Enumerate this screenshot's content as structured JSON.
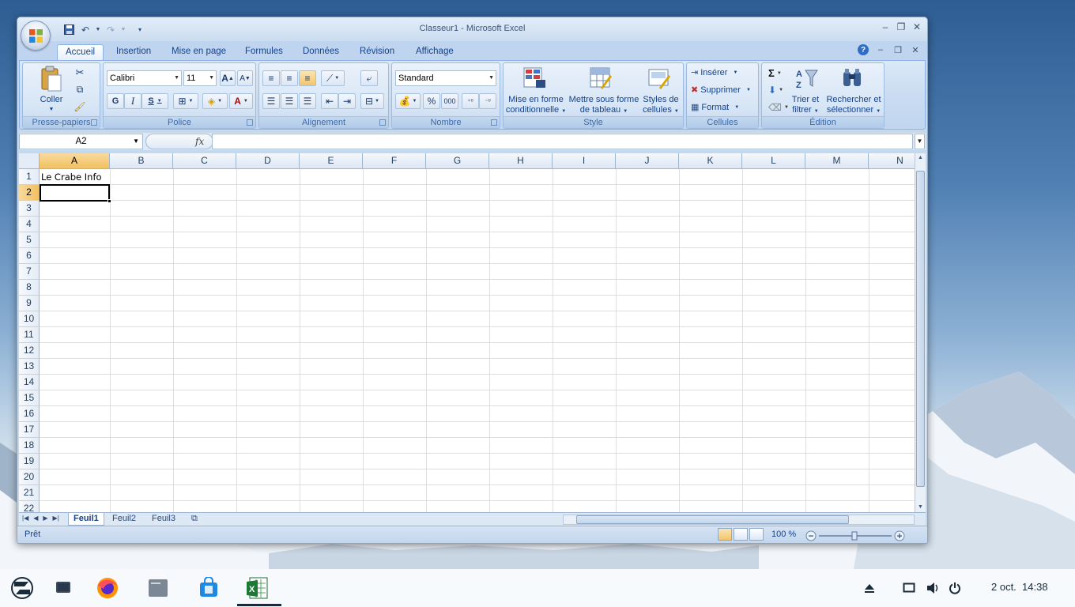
{
  "window": {
    "title": "Classeur1 - Microsoft Excel"
  },
  "ribbon_tabs": [
    "Accueil",
    "Insertion",
    "Mise en page",
    "Formules",
    "Données",
    "Révision",
    "Affichage"
  ],
  "groups": {
    "clipboard": {
      "label": "Presse-papiers",
      "paste": "Coller"
    },
    "font": {
      "label": "Police",
      "font_name": "Calibri",
      "font_size": "11",
      "bold": "G",
      "italic": "I",
      "underline": "S"
    },
    "alignment": {
      "label": "Alignement"
    },
    "number": {
      "label": "Nombre",
      "format": "Standard",
      "percent": "%",
      "thousands": "000"
    },
    "style": {
      "label": "Style",
      "cond_format_1": "Mise en forme",
      "cond_format_2": "conditionnelle",
      "table_1": "Mettre sous forme",
      "table_2": "de tableau",
      "cell_styles_1": "Styles de",
      "cell_styles_2": "cellules"
    },
    "cells": {
      "label": "Cellules",
      "insert": "Insérer",
      "delete": "Supprimer",
      "format": "Format"
    },
    "editing": {
      "label": "Édition",
      "sort_1": "Trier et",
      "sort_2": "filtrer",
      "find_1": "Rechercher et",
      "find_2": "sélectionner"
    }
  },
  "formula_bar": {
    "name_box": "A2",
    "fx": "fx",
    "formula": ""
  },
  "columns": [
    "A",
    "B",
    "C",
    "D",
    "E",
    "F",
    "G",
    "H",
    "I",
    "J",
    "K",
    "L",
    "M",
    "N"
  ],
  "rows": [
    "1",
    "2",
    "3",
    "4",
    "5",
    "6",
    "7",
    "8",
    "9",
    "10",
    "11",
    "12",
    "13",
    "14",
    "15",
    "16",
    "17",
    "18",
    "19",
    "20",
    "21",
    "22"
  ],
  "cells": {
    "A1": "Le Crabe Info"
  },
  "sheet_tabs": [
    "Feuil1",
    "Feuil2",
    "Feuil3"
  ],
  "status": {
    "ready": "Prêt",
    "zoom": "100 %"
  },
  "taskbar": {
    "date": "2 oct.",
    "time": "14:38"
  },
  "colors": {
    "accent": "#15428b",
    "selected_header": "#f1c15f",
    "ribbon_bg": "#c4d8ee"
  }
}
